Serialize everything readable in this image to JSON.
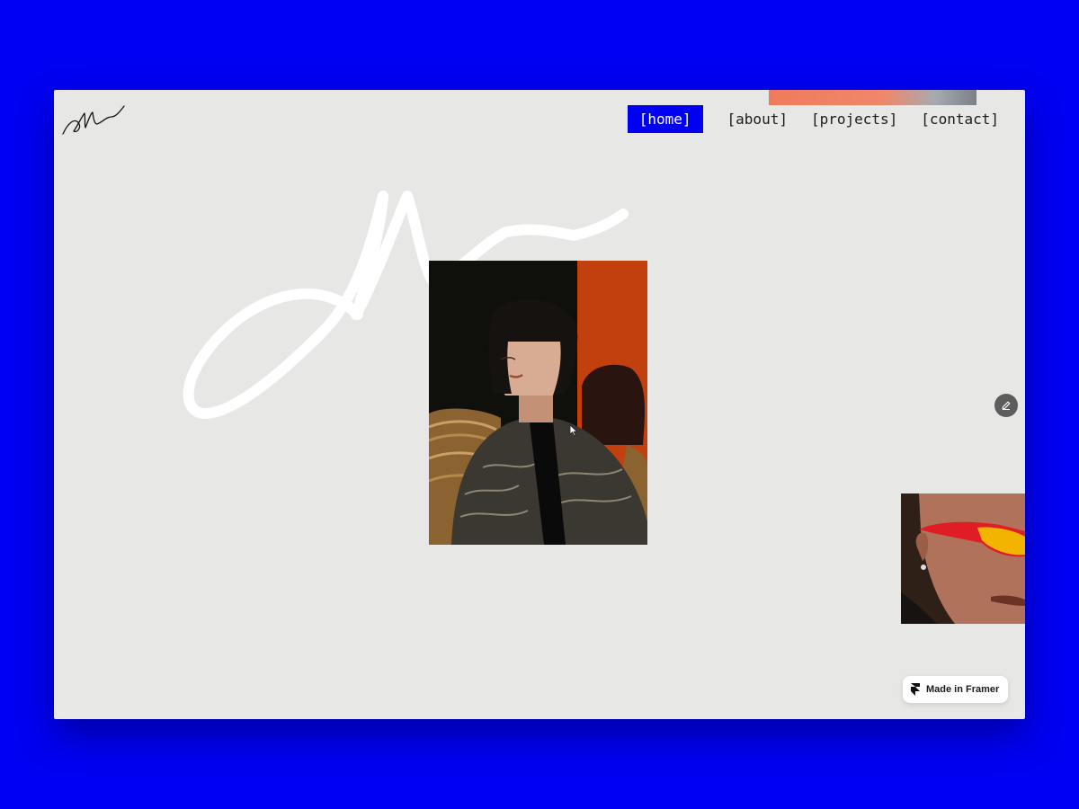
{
  "nav": {
    "items": [
      {
        "label": "[home]",
        "active": true
      },
      {
        "label": "[about]",
        "active": false
      },
      {
        "label": "[projects]",
        "active": false
      },
      {
        "label": "[contact]",
        "active": false
      }
    ]
  },
  "badge": {
    "label": "Made in Framer"
  },
  "icons": {
    "logo": "signature-logo-icon",
    "edit": "pencil-icon",
    "badge": "framer-logo-icon"
  },
  "colors": {
    "background": "#0000f2",
    "canvas": "#e7e7e5",
    "active_nav": "#0000f2",
    "signature": "#ffffff"
  }
}
